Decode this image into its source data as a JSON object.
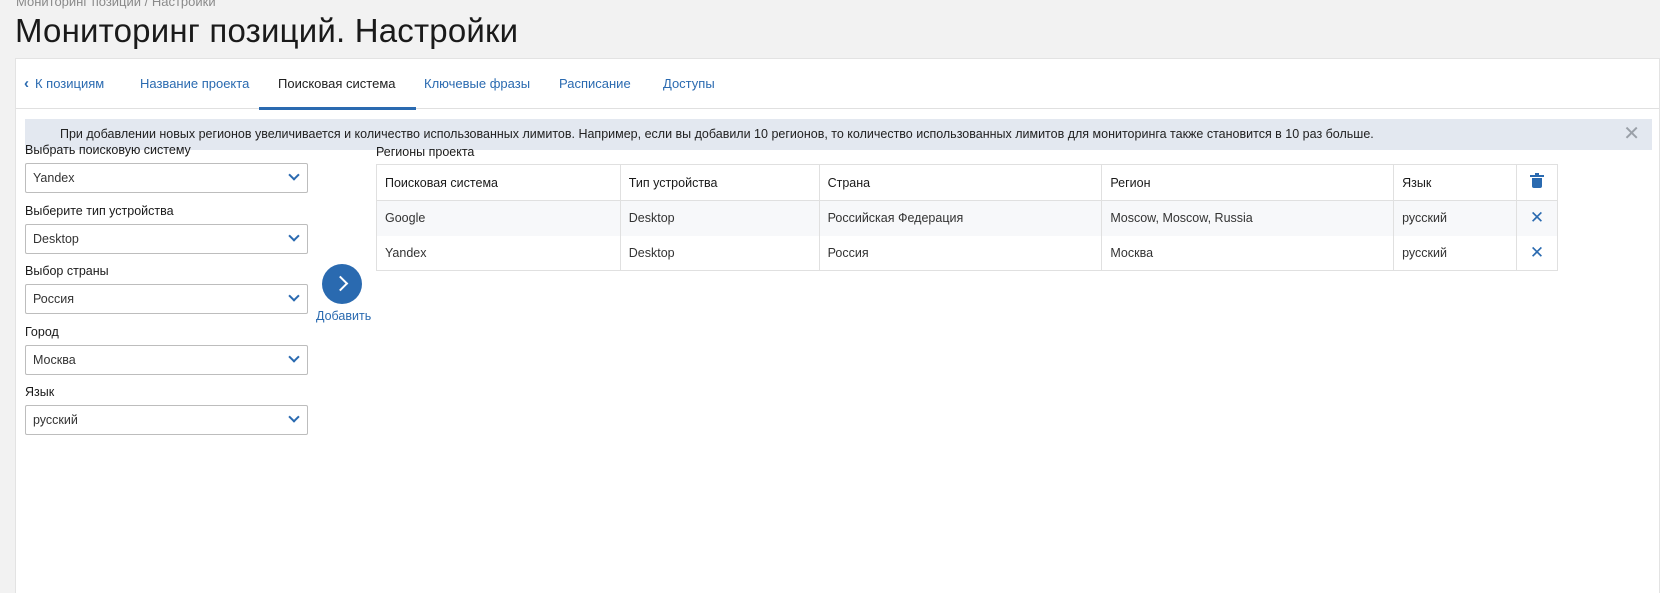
{
  "breadcrumb": "Мониторинг позиций / Настройки",
  "page_title": "Мониторинг позиций. Настройки",
  "tabs": {
    "back": "К позициям",
    "items": [
      "Название проекта",
      "Поисковая система",
      "Ключевые фразы",
      "Расписание",
      "Доступы"
    ],
    "active_index": 1
  },
  "alert": {
    "text": "При добавлении новых регионов увеличивается и количество использованных лимитов. Например, если вы добавили 10 регионов, то количество использованных лимитов для мониторинга также становится в 10 раз больше."
  },
  "form": {
    "search_engine": {
      "label": "Выбрать поисковую систему",
      "value": "Yandex"
    },
    "device": {
      "label": "Выберите тип устройства",
      "value": "Desktop"
    },
    "country": {
      "label": "Выбор страны",
      "value": "Россия"
    },
    "city": {
      "label": "Город",
      "value": "Москва"
    },
    "language": {
      "label": "Язык",
      "value": "русский"
    },
    "add_label": "Добавить"
  },
  "regions": {
    "title": "Регионы проекта",
    "columns": [
      "Поисковая система",
      "Тип устройства",
      "Страна",
      "Регион",
      "Язык"
    ],
    "rows": [
      [
        "Google",
        "Desktop",
        "Российская Федерация",
        "Moscow, Moscow, Russia",
        "русский"
      ],
      [
        "Yandex",
        "Desktop",
        "Россия",
        "Москва",
        "русский"
      ]
    ]
  },
  "colors": {
    "accent": "#2a6ab0",
    "alert_bg": "#e3e8f0"
  },
  "icons": {
    "delete_all": "trash-icon",
    "delete_row": "close-icon",
    "add": "chevron-right-icon",
    "dismiss": "close-icon"
  }
}
